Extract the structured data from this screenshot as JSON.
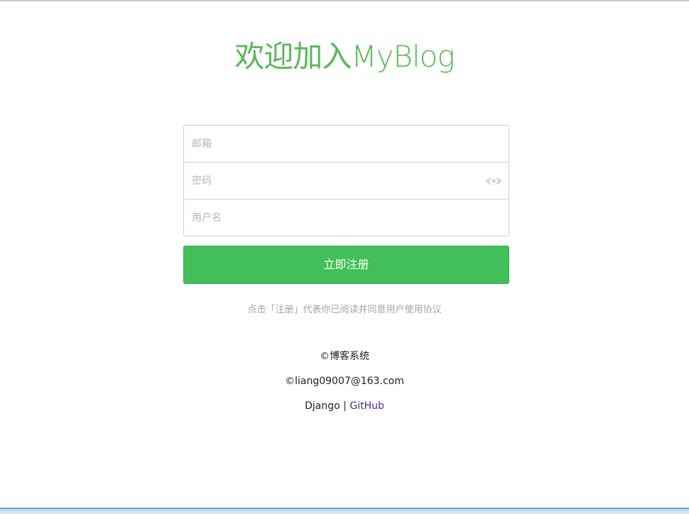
{
  "header": {
    "title": "欢迎加入MyBlog"
  },
  "form": {
    "email_placeholder": "邮箱",
    "password_placeholder": "密码",
    "username_placeholder": "用户名",
    "password_toggle_icon": "eye-icon",
    "submit_label": "立即注册"
  },
  "agreement": {
    "text": "点击「注册」代表你已阅读并同意用户使用协议"
  },
  "footer": {
    "system_name": "©博客系统",
    "contact": "©liang09007@163.com",
    "framework": "Django",
    "separator": "|",
    "github_link": "GitHub"
  },
  "colors": {
    "accent": "#5cb85c",
    "button": "#42bf58",
    "link": "#4b2a88"
  }
}
